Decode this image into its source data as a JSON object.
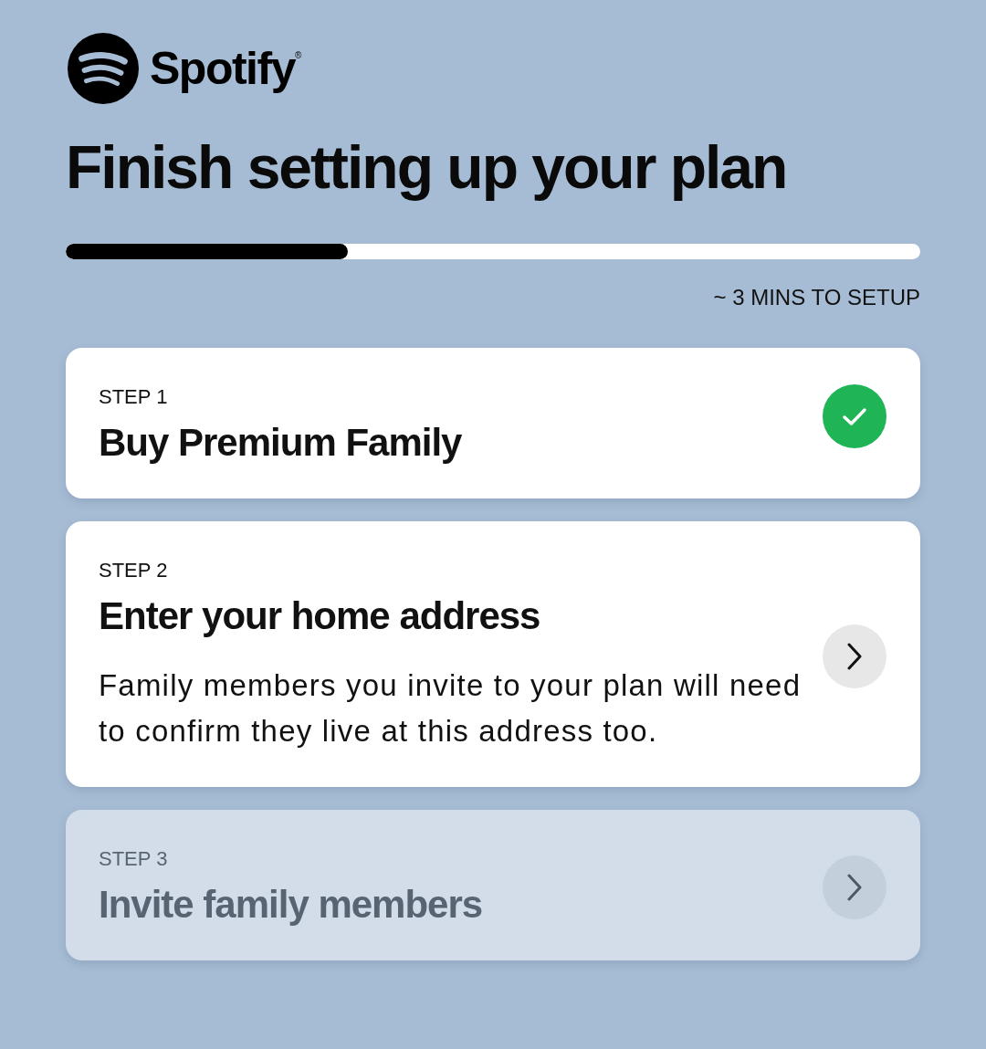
{
  "brand": {
    "wordmark": "Spotify$^{®}$"
  },
  "title": "Finish setting up your plan",
  "progress": {
    "level": 0.33,
    "estimate": "~ 3 MINS TO SETUP"
  },
  "steps": [
    {
      "label": "STEP 1",
      "title": "Buy Premium Family",
      "completed": true,
      "disabled": false
    },
    {
      "label": "STEP 2",
      "title": "Enter your home address",
      "description": "Family members you invite to your plan will need to confirm they live at this address too.",
      "completed": false,
      "disabled": false
    },
    {
      "label": "STEP 3",
      "title": "Invite family members",
      "completed": false,
      "disabled": true
    }
  ]
}
